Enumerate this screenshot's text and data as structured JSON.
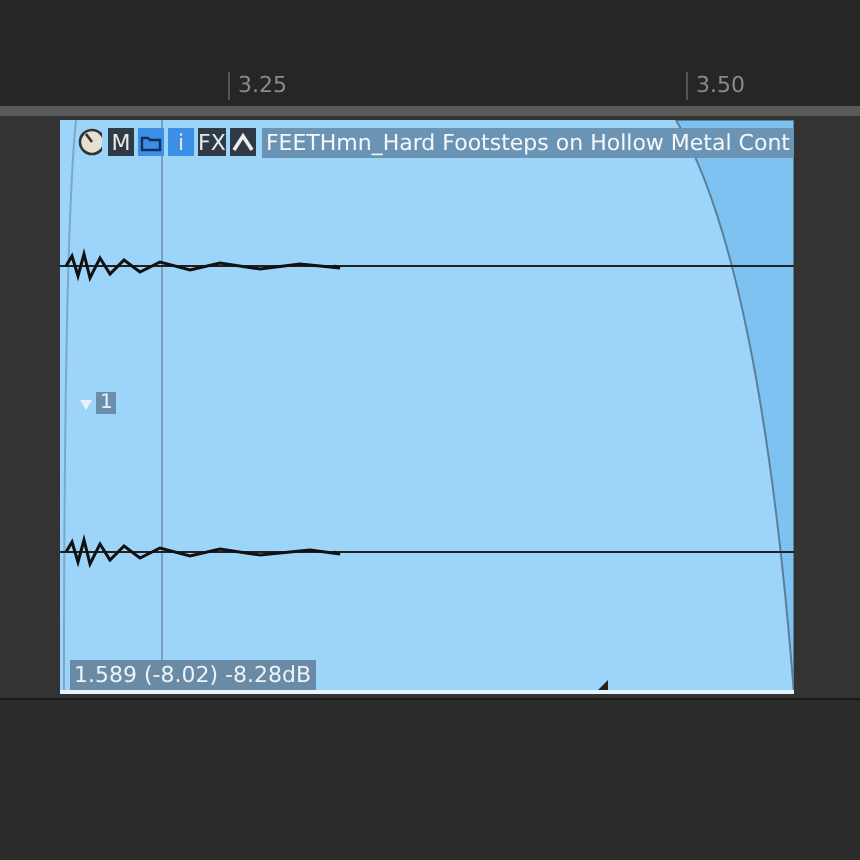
{
  "ruler": {
    "labels": [
      "3.25",
      "3.50"
    ]
  },
  "item": {
    "buttons": [
      {
        "kind": "clock"
      },
      {
        "kind": "text",
        "label": "M"
      },
      {
        "kind": "folder"
      },
      {
        "kind": "text",
        "label": "i",
        "active": true
      },
      {
        "kind": "text",
        "label": "FX"
      },
      {
        "kind": "envelope"
      }
    ],
    "title": "FEETHmn_Hard Footsteps on Hollow Metal Cont",
    "take_marker": "1",
    "status": "1.589 (-8.02) -8.28dB"
  }
}
